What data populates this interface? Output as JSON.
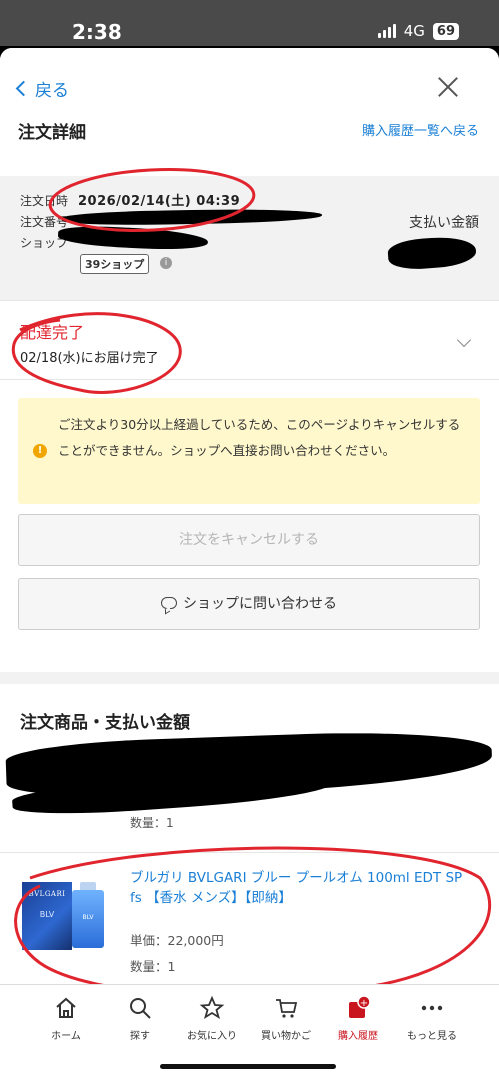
{
  "status_bar": {
    "time": "2:38",
    "network": "4G",
    "battery": "69"
  },
  "header": {
    "back_label": "戻る",
    "title": "注文詳細",
    "history_link": "購入履歴一覧へ戻る"
  },
  "order_info": {
    "date_label": "注文日時",
    "date_value": "2026/02/14(土) 04:39",
    "number_label": "注文番号",
    "shop_label": "ショップ",
    "payment_label": "支払い金額",
    "shop_badge": "39ショップ"
  },
  "delivery": {
    "status": "配達完了",
    "date_text": "02/18(水)にお届け完了"
  },
  "notice": {
    "text": "ご注文より30分以上経過しているため、このページよりキャンセルすることができません。ショップへ直接お問い合わせください。"
  },
  "buttons": {
    "cancel": "注文をキャンセルする",
    "contact": "ショップに問い合わせる"
  },
  "products": {
    "heading": "注文商品・支払い金額",
    "partial_qty": "数量：1",
    "items": [
      {
        "name": "ブルガリ BVLGARI ブルー プールオム 100ml EDT SP fs 【香水 メンズ】【即納】",
        "price": "単価：22,000円",
        "qty": "数量：1",
        "box_brand": "BVLGARI",
        "box_text": "BLV",
        "bottle_text": "BLV"
      }
    ]
  },
  "nav": {
    "items": [
      {
        "label": "ホーム",
        "icon": "home-icon"
      },
      {
        "label": "探す",
        "icon": "search-icon"
      },
      {
        "label": "お気に入り",
        "icon": "star-icon"
      },
      {
        "label": "買い物かご",
        "icon": "cart-icon"
      },
      {
        "label": "購入履歴",
        "icon": "purchase-history-icon",
        "badge": "+"
      },
      {
        "label": "もっと見る",
        "icon": "more-icon"
      }
    ]
  },
  "colors": {
    "link": "#1a7fd6",
    "delivery_status": "#e0252e",
    "notice_bg": "#fff8cc",
    "active_nav": "#c9151e",
    "annotation": "#e0252e"
  }
}
